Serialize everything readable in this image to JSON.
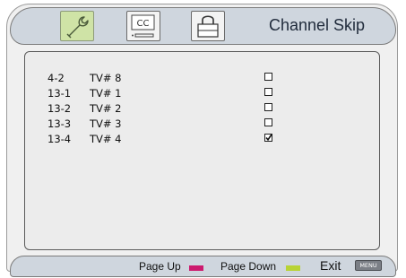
{
  "header": {
    "title": "Channel Skip",
    "tabs": [
      {
        "id": "setup",
        "icon": "wrench-icon",
        "active": true
      },
      {
        "id": "cc",
        "icon": "closed-caption-icon",
        "label": "CC",
        "active": false
      },
      {
        "id": "lock",
        "icon": "padlock-icon",
        "active": false
      }
    ]
  },
  "channels": [
    {
      "number": "4-2",
      "name": "TV# 8",
      "checked": false
    },
    {
      "number": "13-1",
      "name": "TV# 1",
      "checked": false
    },
    {
      "number": "13-2",
      "name": "TV# 2",
      "checked": false
    },
    {
      "number": "13-3",
      "name": "TV# 3",
      "checked": false
    },
    {
      "number": "13-4",
      "name": "TV# 4",
      "checked": true
    }
  ],
  "footer": {
    "page_up": "Page Up",
    "page_down": "Page Down",
    "exit": "Exit",
    "menu_key": "MENU"
  },
  "colors": {
    "page_up_swatch": "#cc1a6e",
    "page_down_swatch": "#b8d335",
    "active_tab": "#cfe3a6",
    "header_bg": "#cfd6de"
  }
}
